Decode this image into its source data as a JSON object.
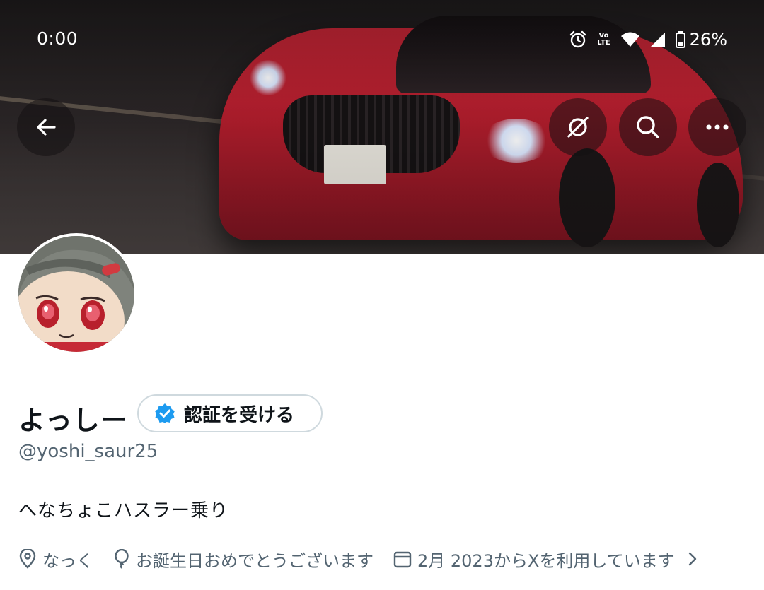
{
  "status_bar": {
    "time": "0:00",
    "battery_percent": "26%",
    "icons": [
      "alarm-icon",
      "volte-icon",
      "wifi-icon",
      "cell-signal-icon",
      "battery-icon"
    ],
    "volte_text_top": "Vo",
    "volte_text_bottom": "LTE"
  },
  "header": {
    "buttons": [
      "back-arrow-icon",
      "notifications-off-icon",
      "search-icon",
      "more-icon"
    ]
  },
  "profile": {
    "display_name": "よっしー",
    "verify_button_label": "認証を受ける",
    "handle": "@yoshi_saur25",
    "bio": "へなちょこハスラー乗り",
    "location": "なっく",
    "birthday": "お誕生日おめでとうございます",
    "joined": "2月 2023からXを利用しています"
  },
  "colors": {
    "verified_blue": "#1d9bf0",
    "muted_text": "#536471",
    "primary_text": "#0f1419"
  }
}
